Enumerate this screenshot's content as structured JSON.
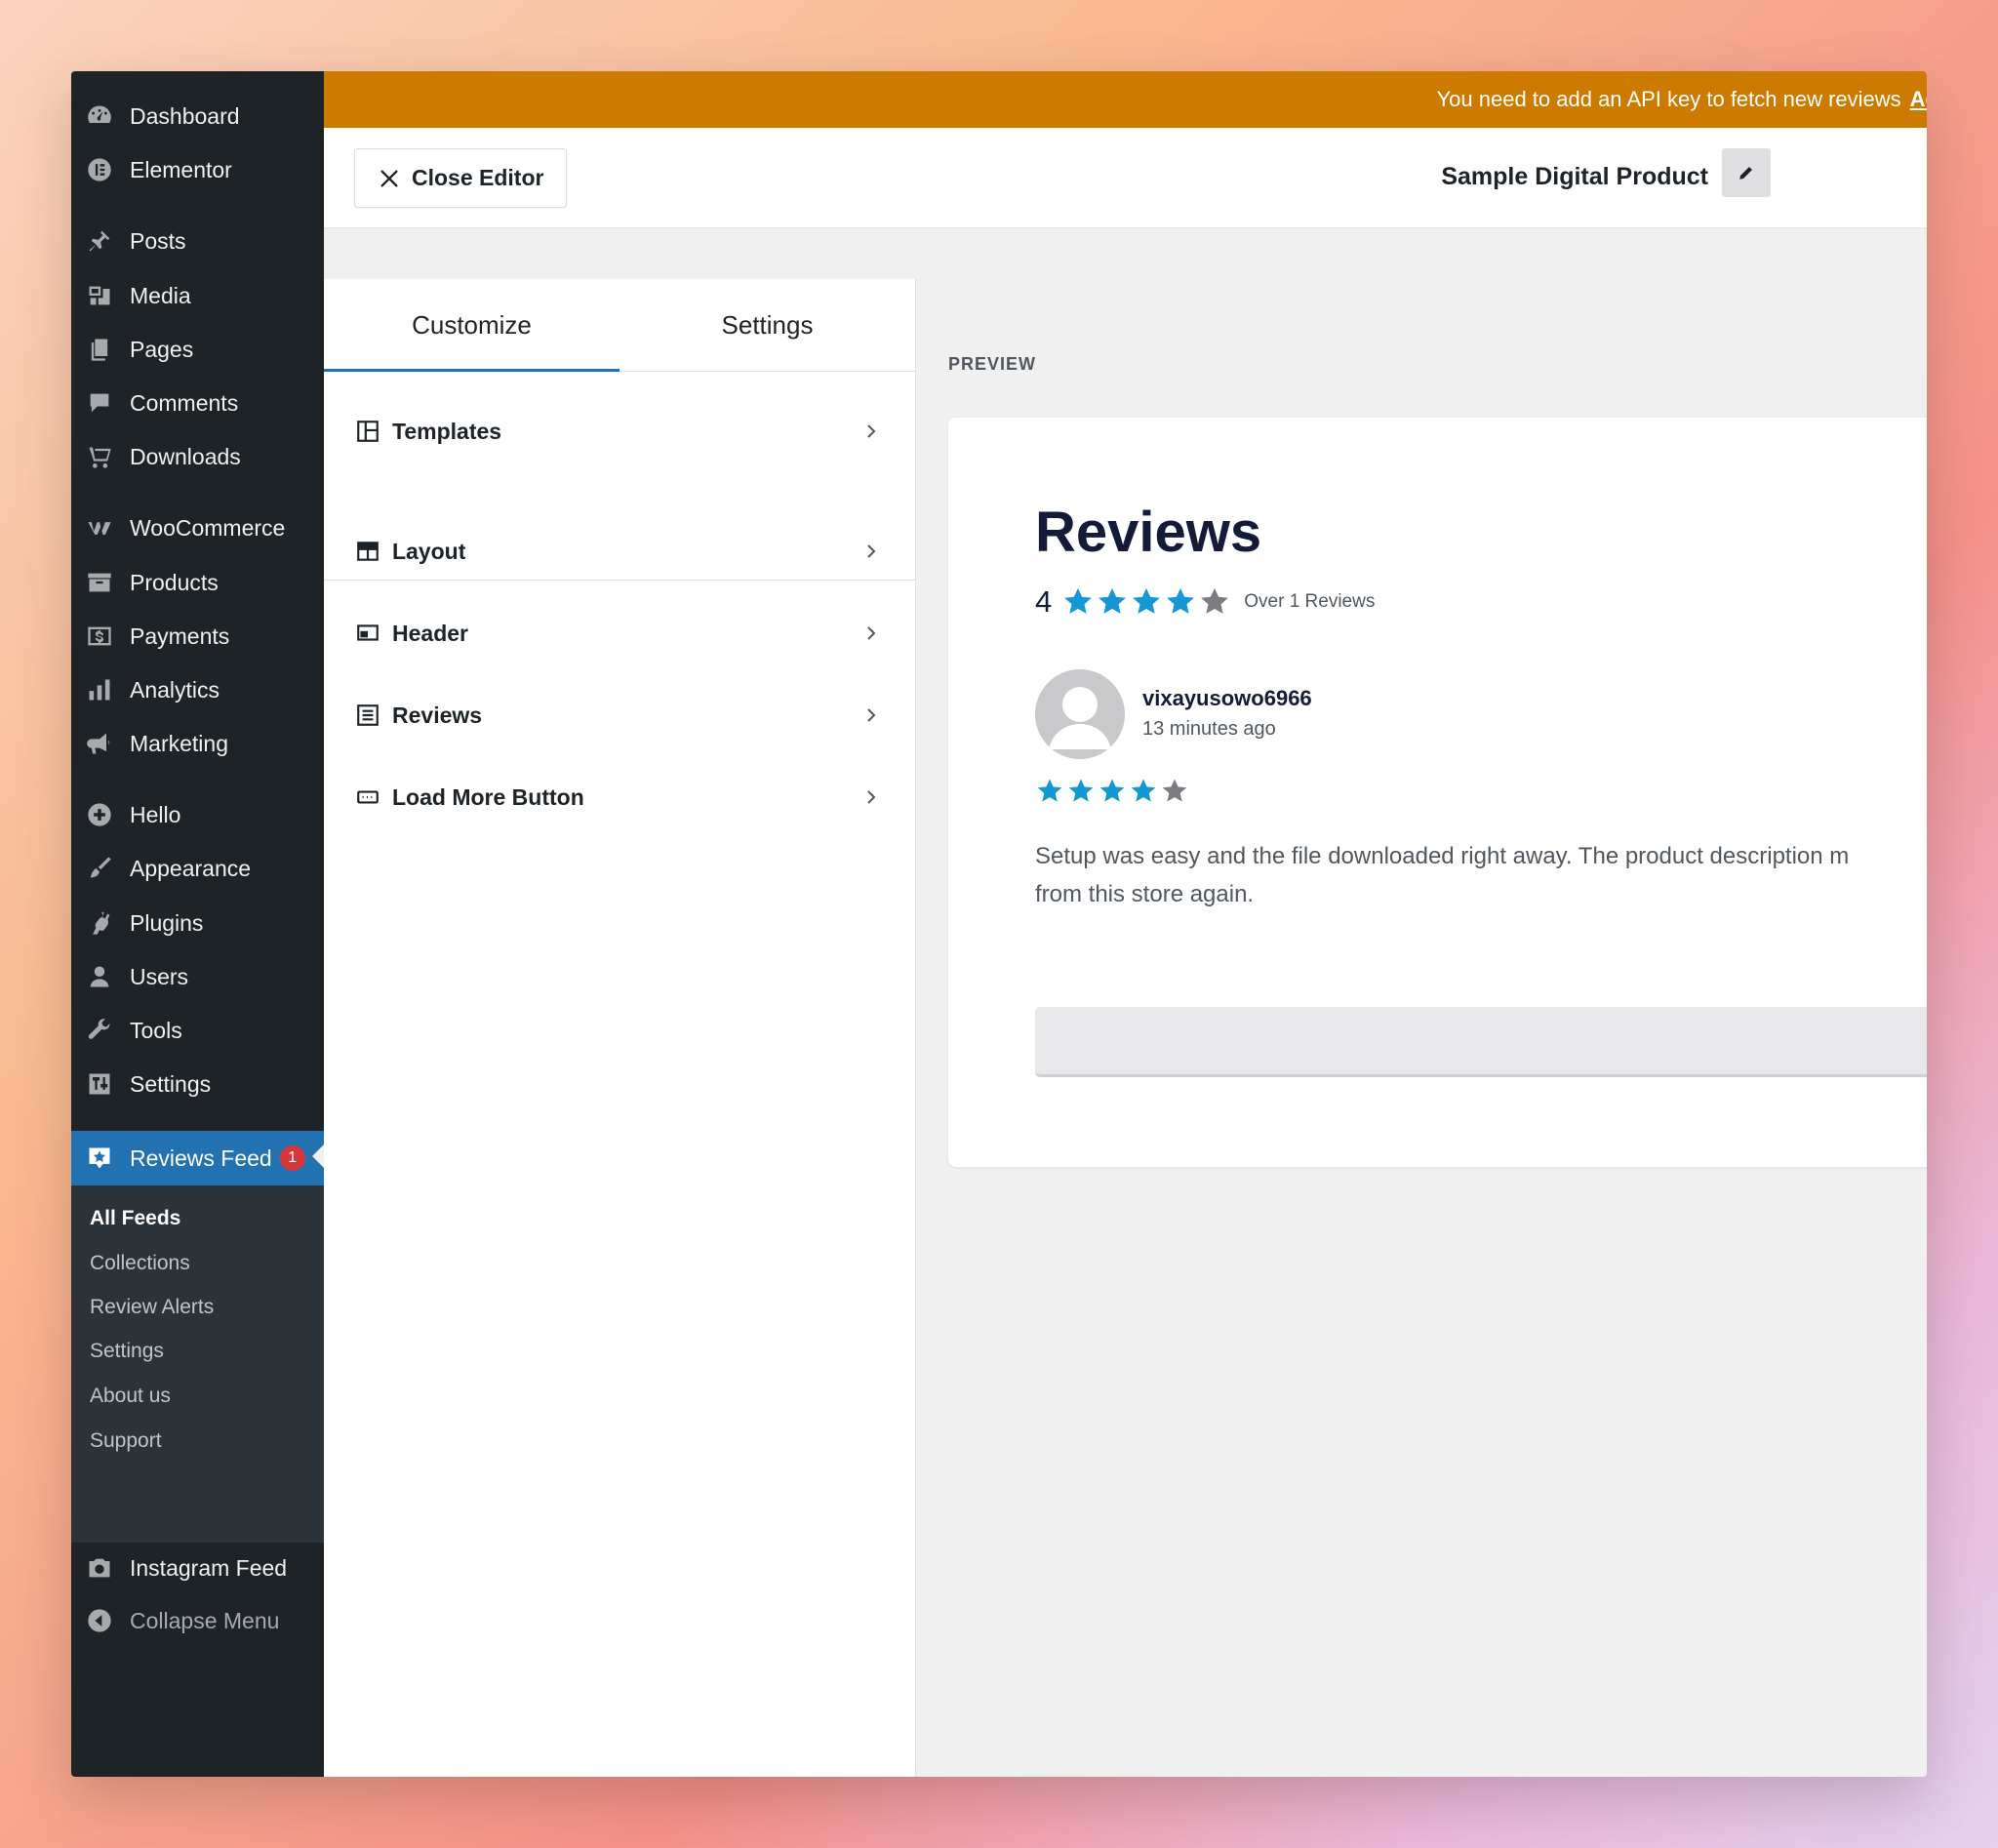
{
  "sidebar": {
    "items": [
      {
        "label": "Dashboard",
        "icon": "dashboard-icon"
      },
      {
        "label": "Elementor",
        "icon": "elementor-icon"
      },
      {
        "label": "Posts",
        "icon": "pin-icon"
      },
      {
        "label": "Media",
        "icon": "media-icon"
      },
      {
        "label": "Pages",
        "icon": "pages-icon"
      },
      {
        "label": "Comments",
        "icon": "comment-icon"
      },
      {
        "label": "Downloads",
        "icon": "cart-icon"
      },
      {
        "label": "WooCommerce",
        "icon": "woocommerce-icon"
      },
      {
        "label": "Products",
        "icon": "archive-icon"
      },
      {
        "label": "Payments",
        "icon": "dollar-icon"
      },
      {
        "label": "Analytics",
        "icon": "bar-chart-icon"
      },
      {
        "label": "Marketing",
        "icon": "megaphone-icon"
      },
      {
        "label": "Hello",
        "icon": "plus-circle-icon"
      },
      {
        "label": "Appearance",
        "icon": "brush-icon"
      },
      {
        "label": "Plugins",
        "icon": "plug-icon"
      },
      {
        "label": "Users",
        "icon": "user-icon"
      },
      {
        "label": "Tools",
        "icon": "wrench-icon"
      },
      {
        "label": "Settings",
        "icon": "sliders-icon"
      }
    ],
    "active": {
      "label": "Reviews Feed",
      "badge": "1",
      "icon": "star-badge-icon"
    },
    "submenu": [
      "All Feeds",
      "Collections",
      "Review Alerts",
      "Settings",
      "About us",
      "Support"
    ],
    "after": {
      "label": "Instagram Feed",
      "icon": "camera-icon"
    },
    "collapse": {
      "label": "Collapse Menu",
      "icon": "collapse-arrow-icon"
    }
  },
  "notice": {
    "text": "You need to add an API key to fetch new reviews",
    "link": "Ad"
  },
  "header": {
    "close_label": "Close Editor",
    "feed_title": "Sample Digital Product"
  },
  "panel": {
    "tabs": [
      "Customize",
      "Settings"
    ],
    "active_tab": "Customize",
    "sections": [
      {
        "label": "Templates",
        "icon": "templates-icon"
      },
      {
        "label": "Layout",
        "icon": "layout-grid-icon"
      },
      {
        "label": "Header",
        "icon": "header-icon"
      },
      {
        "label": "Reviews",
        "icon": "reviews-list-icon"
      },
      {
        "label": "Load More Button",
        "icon": "button-icon"
      }
    ]
  },
  "preview": {
    "label": "PREVIEW",
    "title": "Reviews",
    "rating": "4",
    "rating_stars": 4,
    "rating_meta": "Over 1 Reviews",
    "review": {
      "author": "vixayusowo6966",
      "time": "13 minutes ago",
      "stars": 4,
      "text_line1": "Setup was easy and the file downloaded right away. The product description m",
      "text_line2": "from this store again."
    }
  },
  "colors": {
    "sidebar_bg": "#1d2327",
    "accent": "#2271b1",
    "notice_bg": "#cc7a00",
    "star_filled": "#1597d4",
    "star_empty": "#7c7c80",
    "badge": "#d63638"
  }
}
